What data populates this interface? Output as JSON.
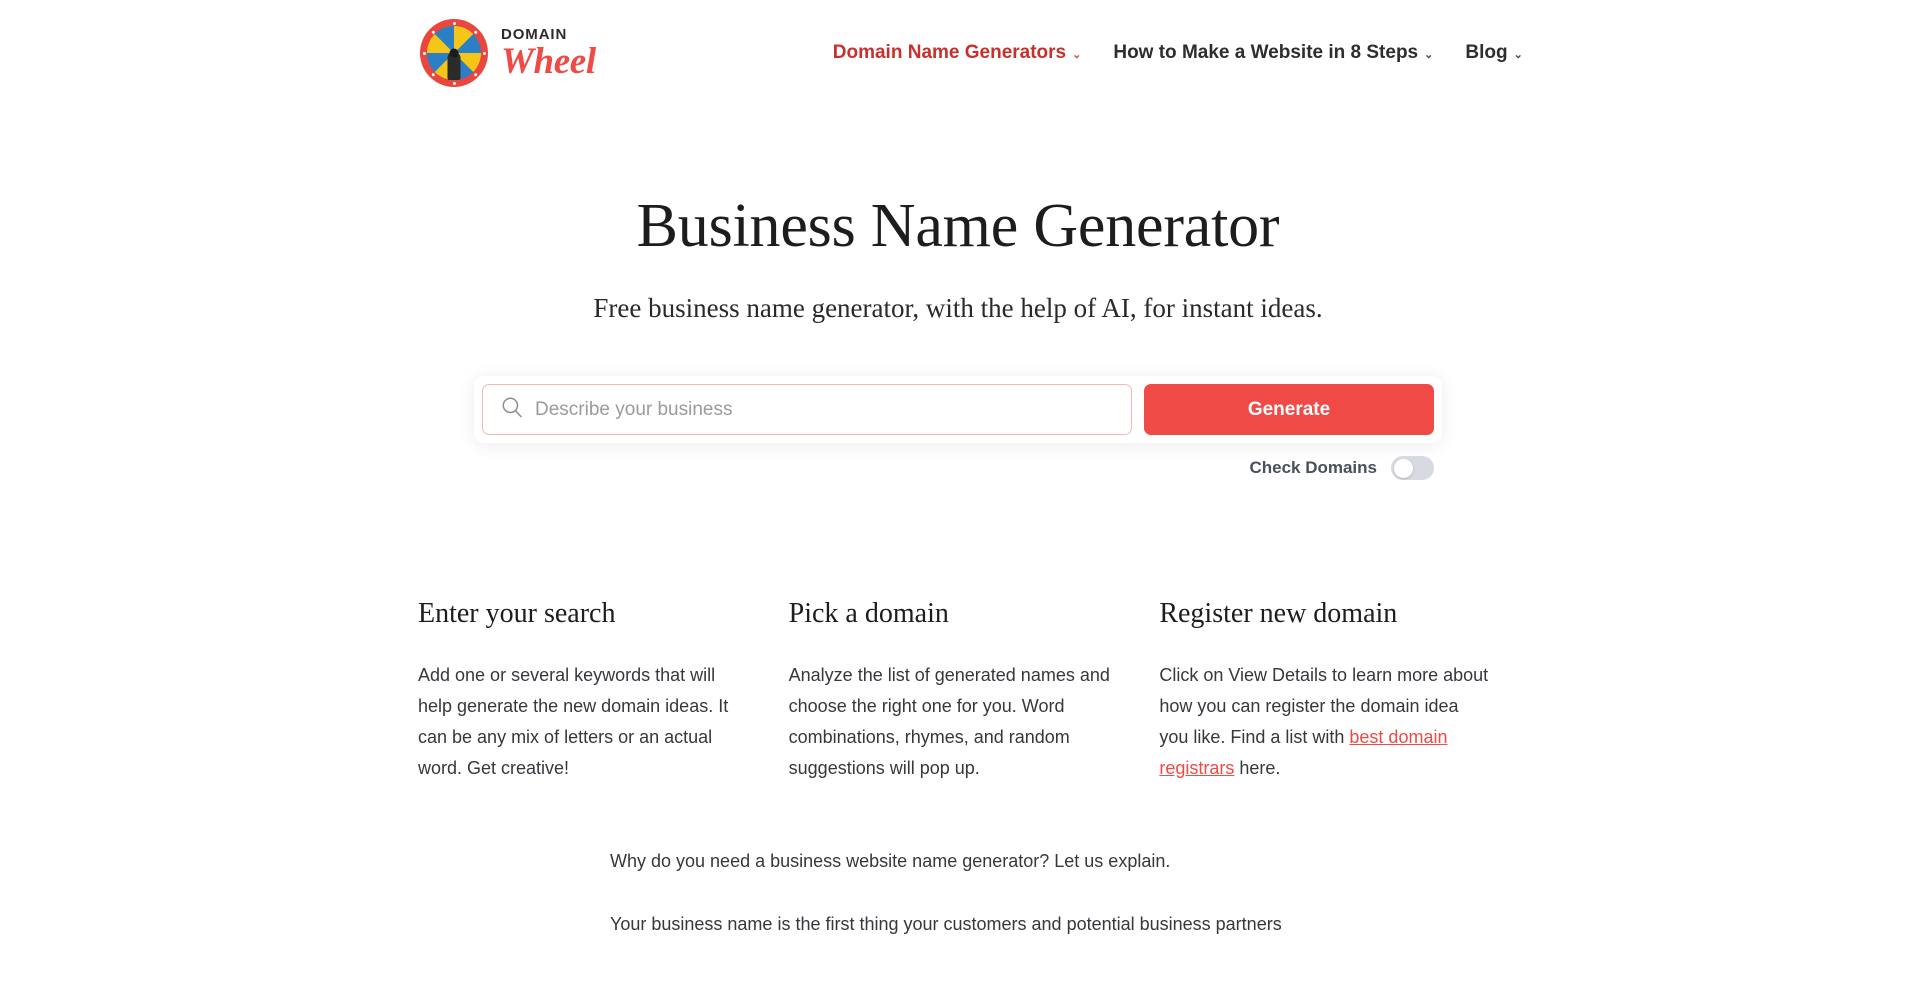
{
  "colors": {
    "brand_red": "#ef4a45",
    "nav_active_red": "#c9302c",
    "link_red": "#ef4a45",
    "text_dark": "#1d1d1d",
    "body_text": "#35383d",
    "input_border": "#f2b9b7",
    "toggle_track": "#d7dae0",
    "wheel_ring": "#e8463f",
    "wheel_yellow": "#f5c518",
    "wheel_blue": "#2b7fc4"
  },
  "header": {
    "brand": {
      "top_text": "DOMAIN",
      "bottom_text": "Wheel",
      "logo_icon": "prize-wheel-icon"
    },
    "nav": [
      {
        "label": "Domain Name Generators",
        "has_dropdown": true,
        "active": true
      },
      {
        "label": "How to Make a Website in 8 Steps",
        "has_dropdown": true,
        "active": false
      },
      {
        "label": "Blog",
        "has_dropdown": true,
        "active": false
      }
    ],
    "chevron_glyph": "⌄"
  },
  "hero": {
    "title": "Business Name Generator",
    "subtitle": "Free business name generator, with the help of AI, for instant ideas."
  },
  "search": {
    "icon": "search-icon",
    "placeholder": "Describe your business",
    "value": "",
    "button_label": "Generate"
  },
  "check_domains": {
    "label": "Check Domains",
    "state": "off"
  },
  "steps": [
    {
      "title": "Enter your search",
      "body": "Add one or several keywords that will help generate the new domain ideas. It can be any mix of letters or an actual word. Get creative!"
    },
    {
      "title": "Pick a domain",
      "body": "Analyze the list of generated names and choose the right one for you. Word combinations, rhymes, and random suggestions will pop up."
    },
    {
      "title": "Register new domain",
      "body_before_link": "Click on View Details to learn more about how you can register the domain idea you like. Find a list with ",
      "link_text": "best domain registrars",
      "body_after_link": " here."
    }
  ],
  "explain": {
    "intro": "Why do you need a business website name generator? Let us explain.",
    "paragraph": "Your business name is the first thing your customers and potential business partners"
  }
}
